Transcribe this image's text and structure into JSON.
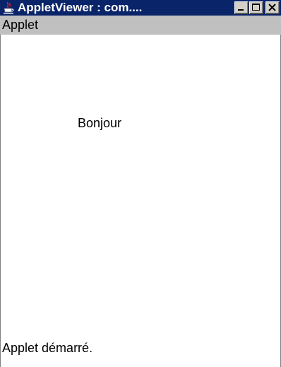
{
  "window": {
    "title": "AppletViewer : com....",
    "icon": "java-coffee-icon"
  },
  "title_buttons": {
    "minimize": "minimize-icon",
    "maximize": "maximize-icon",
    "close": "close-icon"
  },
  "menubar": {
    "items": [
      {
        "label": "Applet"
      }
    ]
  },
  "applet": {
    "text": "Bonjour"
  },
  "statusbar": {
    "text": "Applet démarré."
  },
  "colors": {
    "titlebar": "#0a246a",
    "menubar": "#c0c0c0",
    "content": "#ffffff"
  }
}
